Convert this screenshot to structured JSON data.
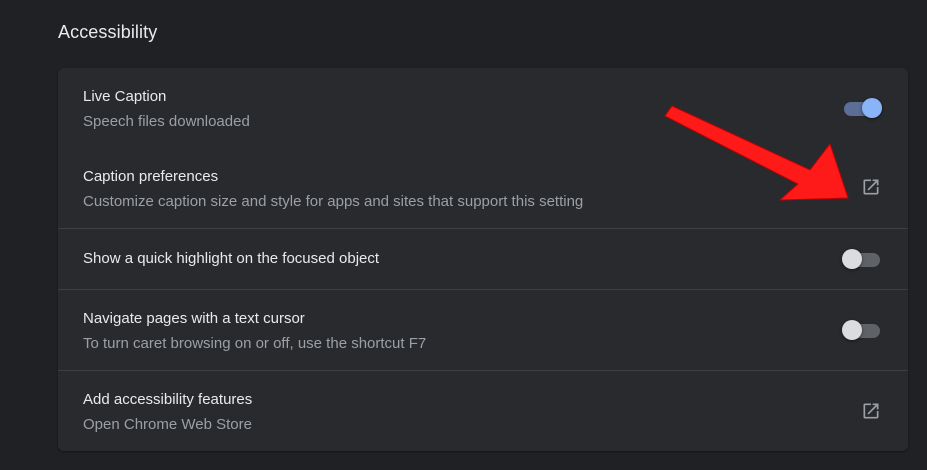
{
  "section": {
    "title": "Accessibility"
  },
  "rows": [
    {
      "label": "Live Caption",
      "sub": "Speech files downloaded",
      "control": "toggle",
      "checked": true
    },
    {
      "label": "Caption preferences",
      "sub": "Customize caption size and style for apps and sites that support this setting",
      "control": "open-in-new-icon"
    },
    {
      "label": "Show a quick highlight on the focused object",
      "control": "toggle",
      "checked": false
    },
    {
      "label": "Navigate pages with a text cursor",
      "sub": "To turn caret browsing on or off, use the shortcut F7",
      "control": "toggle",
      "checked": false
    },
    {
      "label": "Add accessibility features",
      "sub": "Open Chrome Web Store",
      "control": "open-in-new-icon"
    }
  ],
  "colors": {
    "background": "#202124",
    "card": "#292a2d",
    "accent": "#8ab4f8",
    "annotation_arrow": "#ff0000"
  }
}
